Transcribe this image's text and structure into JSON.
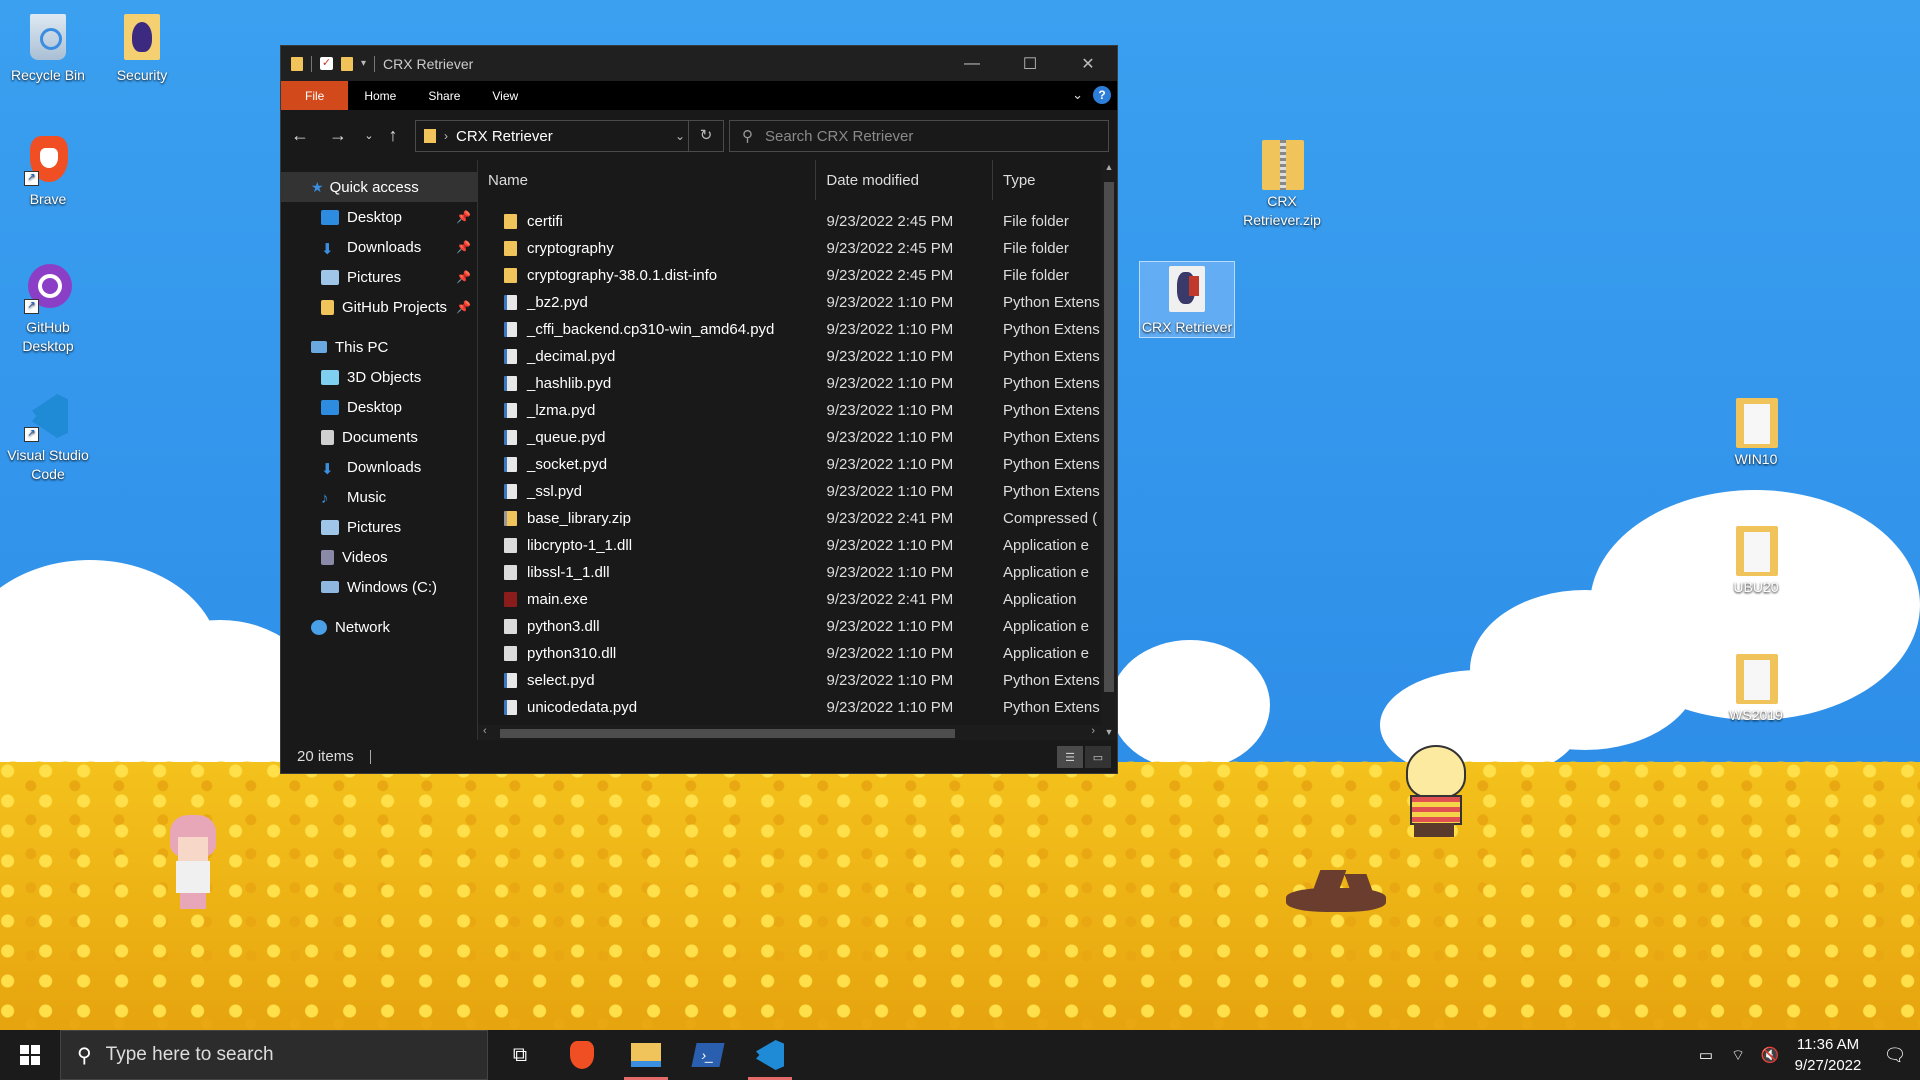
{
  "desktop": {
    "icons_left": [
      {
        "label": "Recycle Bin",
        "icon": "recycle-bin-icon"
      },
      {
        "label": "Security",
        "icon": "security-icon"
      },
      {
        "label": "Brave",
        "icon": "brave-icon"
      },
      {
        "label": "GitHub Desktop",
        "icon": "github-icon"
      },
      {
        "label": "Visual Studio Code",
        "icon": "vscode-icon"
      }
    ],
    "icons_right": [
      {
        "label": "CRX Retriever.zip",
        "icon": "zip-folder-icon"
      },
      {
        "label": "CRX Retriever",
        "icon": "app-icon"
      },
      {
        "label": "WIN10",
        "icon": "folder-icon"
      },
      {
        "label": "UBU20",
        "icon": "folder-icon"
      },
      {
        "label": "WS2019",
        "icon": "folder-icon"
      }
    ]
  },
  "window": {
    "title": "CRX Retriever",
    "ribbon_tabs": [
      "File",
      "Home",
      "Share",
      "View"
    ],
    "address": "CRX Retriever",
    "search_placeholder": "Search CRX Retriever",
    "status_count": "20 items"
  },
  "nav": {
    "quick_access": "Quick access",
    "quick_items": [
      "Desktop",
      "Downloads",
      "Pictures",
      "GitHub Projects"
    ],
    "this_pc": "This PC",
    "pc_items": [
      "3D Objects",
      "Desktop",
      "Documents",
      "Downloads",
      "Music",
      "Pictures",
      "Videos",
      "Windows (C:)"
    ],
    "network": "Network"
  },
  "columns": {
    "name": "Name",
    "date": "Date modified",
    "type": "Type"
  },
  "files": [
    {
      "name": "certifi",
      "date": "9/23/2022 2:45 PM",
      "type": "File folder",
      "kind": "folder"
    },
    {
      "name": "cryptography",
      "date": "9/23/2022 2:45 PM",
      "type": "File folder",
      "kind": "folder"
    },
    {
      "name": "cryptography-38.0.1.dist-info",
      "date": "9/23/2022 2:45 PM",
      "type": "File folder",
      "kind": "folder"
    },
    {
      "name": "_bz2.pyd",
      "date": "9/23/2022 1:10 PM",
      "type": "Python Extens",
      "kind": "pyd"
    },
    {
      "name": "_cffi_backend.cp310-win_amd64.pyd",
      "date": "9/23/2022 1:10 PM",
      "type": "Python Extens",
      "kind": "pyd"
    },
    {
      "name": "_decimal.pyd",
      "date": "9/23/2022 1:10 PM",
      "type": "Python Extens",
      "kind": "pyd"
    },
    {
      "name": "_hashlib.pyd",
      "date": "9/23/2022 1:10 PM",
      "type": "Python Extens",
      "kind": "pyd"
    },
    {
      "name": "_lzma.pyd",
      "date": "9/23/2022 1:10 PM",
      "type": "Python Extens",
      "kind": "pyd"
    },
    {
      "name": "_queue.pyd",
      "date": "9/23/2022 1:10 PM",
      "type": "Python Extens",
      "kind": "pyd"
    },
    {
      "name": "_socket.pyd",
      "date": "9/23/2022 1:10 PM",
      "type": "Python Extens",
      "kind": "pyd"
    },
    {
      "name": "_ssl.pyd",
      "date": "9/23/2022 1:10 PM",
      "type": "Python Extens",
      "kind": "pyd"
    },
    {
      "name": "base_library.zip",
      "date": "9/23/2022 2:41 PM",
      "type": "Compressed (",
      "kind": "zip"
    },
    {
      "name": "libcrypto-1_1.dll",
      "date": "9/23/2022 1:10 PM",
      "type": "Application e",
      "kind": "dll"
    },
    {
      "name": "libssl-1_1.dll",
      "date": "9/23/2022 1:10 PM",
      "type": "Application e",
      "kind": "dll"
    },
    {
      "name": "main.exe",
      "date": "9/23/2022 2:41 PM",
      "type": "Application",
      "kind": "exe"
    },
    {
      "name": "python3.dll",
      "date": "9/23/2022 1:10 PM",
      "type": "Application e",
      "kind": "dll"
    },
    {
      "name": "python310.dll",
      "date": "9/23/2022 1:10 PM",
      "type": "Application e",
      "kind": "dll"
    },
    {
      "name": "select.pyd",
      "date": "9/23/2022 1:10 PM",
      "type": "Python Extens",
      "kind": "pyd"
    },
    {
      "name": "unicodedata.pyd",
      "date": "9/23/2022 1:10 PM",
      "type": "Python Extens",
      "kind": "pyd"
    }
  ],
  "taskbar": {
    "search_placeholder": "Type here to search",
    "apps": [
      "task-view-icon",
      "brave-icon",
      "file-explorer-icon",
      "powershell-icon",
      "vscode-icon"
    ],
    "time": "11:36 AM",
    "date": "9/27/2022"
  },
  "colors": {
    "accent_file_tab": "#d24a1b",
    "folder": "#f1c45b",
    "taskbar": "#1b1b1b"
  }
}
